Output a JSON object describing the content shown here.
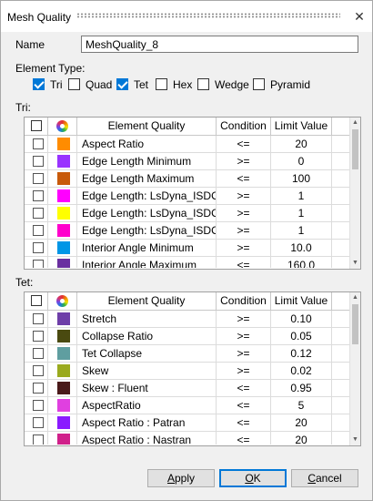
{
  "dialog": {
    "title": "Mesh Quality"
  },
  "name": {
    "label": "Name",
    "value": "MeshQuality_8"
  },
  "element_type": {
    "label": "Element Type:",
    "options": [
      {
        "label": "Tri",
        "checked": true
      },
      {
        "label": "Quad",
        "checked": false
      },
      {
        "label": "Tet",
        "checked": true
      },
      {
        "label": "Hex",
        "checked": false
      },
      {
        "label": "Wedge",
        "checked": false
      },
      {
        "label": "Pyramid",
        "checked": false
      }
    ]
  },
  "columns": {
    "quality": "Element Quality",
    "condition": "Condition",
    "limit": "Limit Value"
  },
  "tri": {
    "label": "Tri:",
    "rows": [
      {
        "color": "#ff8c00",
        "quality": "Aspect Ratio",
        "condition": "<=",
        "limit": "20"
      },
      {
        "color": "#9933ff",
        "quality": "Edge Length Minimum",
        "condition": ">=",
        "limit": "0"
      },
      {
        "color": "#c85a0a",
        "quality": "Edge Length Maximum",
        "condition": "<=",
        "limit": "100"
      },
      {
        "color": "#ff00ff",
        "quality": "Edge Length: LsDyna_ISDO_0",
        "condition": ">=",
        "limit": "1"
      },
      {
        "color": "#ffff00",
        "quality": "Edge Length: LsDyna_ISDO_1",
        "condition": ">=",
        "limit": "1"
      },
      {
        "color": "#ff00cc",
        "quality": "Edge Length: LsDyna_ISDO_2",
        "condition": ">=",
        "limit": "1"
      },
      {
        "color": "#0096e6",
        "quality": "Interior Angle Minimum",
        "condition": ">=",
        "limit": "10.0"
      },
      {
        "color": "#6a2fa0",
        "quality": "Interior Angle Maximum",
        "condition": "<=",
        "limit": "160.0"
      }
    ]
  },
  "tet": {
    "label": "Tet:",
    "rows": [
      {
        "color": "#6e3ea8",
        "quality": "Stretch",
        "condition": ">=",
        "limit": "0.10"
      },
      {
        "color": "#4a4a10",
        "quality": "Collapse Ratio",
        "condition": ">=",
        "limit": "0.05"
      },
      {
        "color": "#5f9ea0",
        "quality": "Tet Collapse",
        "condition": ">=",
        "limit": "0.12"
      },
      {
        "color": "#9aaa1e",
        "quality": "Skew",
        "condition": ">=",
        "limit": "0.02"
      },
      {
        "color": "#4a1a1a",
        "quality": "Skew : Fluent",
        "condition": "<=",
        "limit": "0.95"
      },
      {
        "color": "#e040e0",
        "quality": "AspectRatio",
        "condition": "<=",
        "limit": "5"
      },
      {
        "color": "#8a1aff",
        "quality": "Aspect Ratio : Patran",
        "condition": "<=",
        "limit": "20"
      },
      {
        "color": "#d0208a",
        "quality": "Aspect Ratio : Nastran",
        "condition": "<=",
        "limit": "20"
      }
    ]
  },
  "buttons": {
    "apply": "Apply",
    "ok": "OK",
    "cancel": "Cancel"
  }
}
